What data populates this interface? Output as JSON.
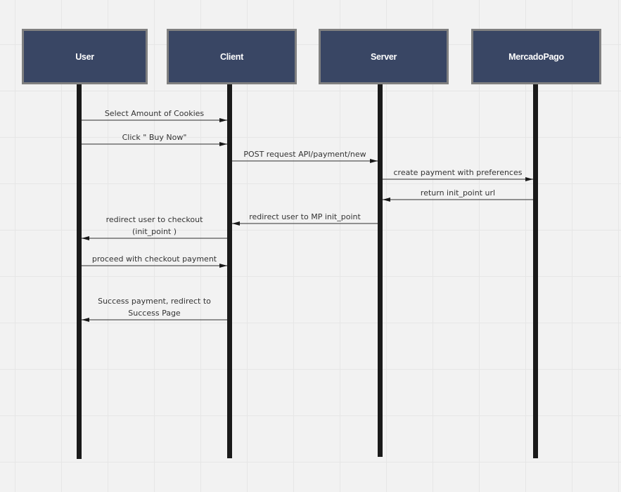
{
  "diagram": {
    "type": "sequence",
    "colors": {
      "actor_fill": "#394664",
      "actor_border": "#808080",
      "lifeline": "#1a1a1a",
      "background": "#f2f2f2"
    },
    "actors": [
      {
        "id": "user",
        "label": "User"
      },
      {
        "id": "client",
        "label": "Client"
      },
      {
        "id": "server",
        "label": "Server"
      },
      {
        "id": "mercadopago",
        "label": "MercadoPago"
      }
    ],
    "messages": [
      {
        "from": "user",
        "to": "client",
        "lines": [
          "Select Amount of Cookies"
        ]
      },
      {
        "from": "user",
        "to": "client",
        "lines": [
          "Click \" Buy Now\""
        ]
      },
      {
        "from": "client",
        "to": "server",
        "lines": [
          "POST request  API/payment/new"
        ]
      },
      {
        "from": "server",
        "to": "mercadopago",
        "lines": [
          "create payment with preferences"
        ]
      },
      {
        "from": "mercadopago",
        "to": "server",
        "lines": [
          "return init_point url"
        ]
      },
      {
        "from": "server",
        "to": "client",
        "lines": [
          "redirect user to MP init_point"
        ]
      },
      {
        "from": "client",
        "to": "user",
        "lines": [
          "redirect user to checkout",
          "(init_point )"
        ]
      },
      {
        "from": "user",
        "to": "client",
        "lines": [
          "proceed with checkout payment"
        ]
      },
      {
        "from": "client",
        "to": "user",
        "lines": [
          "Success payment, redirect to",
          "Success Page"
        ]
      }
    ]
  }
}
